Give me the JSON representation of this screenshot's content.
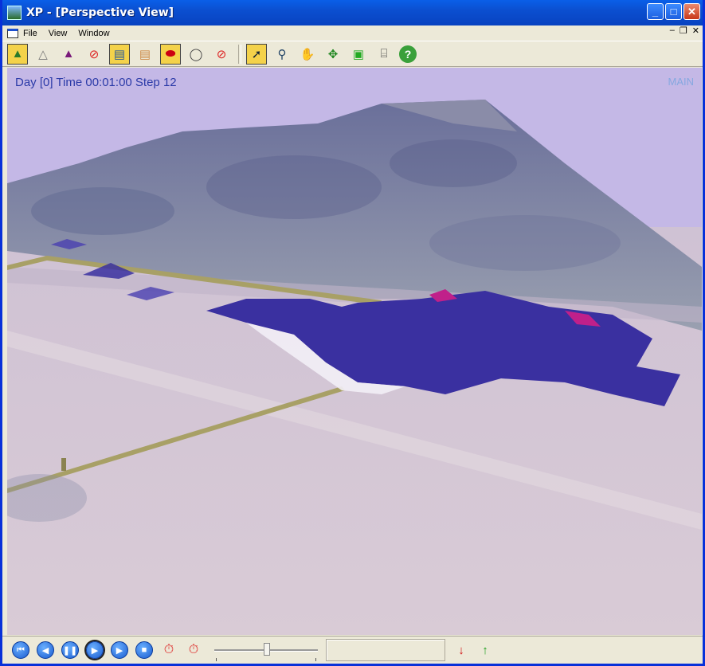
{
  "window": {
    "title": "XP - [Perspective View]"
  },
  "menu": {
    "items": [
      "File",
      "View",
      "Window"
    ]
  },
  "view": {
    "status": "Day [0] Time 00:01:00 Step 12",
    "label": "MAIN"
  },
  "colors": {
    "sky": "#c4b8e6",
    "plume": "#3a30a0",
    "plume_peak": "#c0208a",
    "terrain": "#d8cad6"
  }
}
